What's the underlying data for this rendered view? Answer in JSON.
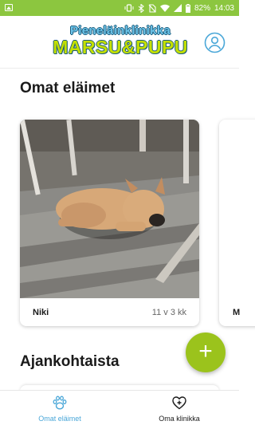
{
  "status_bar": {
    "battery": "82%",
    "time": "14:03"
  },
  "header": {
    "logo_line1": "Pieneläinklinikka",
    "logo_line2": "MARSU&PUPU",
    "profile_icon": "account-circle-icon"
  },
  "pets_section": {
    "title": "Omat eläimet",
    "pets": [
      {
        "name": "Niki",
        "age": "11 v 3 kk"
      },
      {
        "name": "M"
      }
    ]
  },
  "news_section": {
    "title": "Ajankohtaista"
  },
  "fab": {
    "label": "+"
  },
  "bottom_nav": {
    "items": [
      {
        "label": "Omat eläimet",
        "icon": "paw-icon",
        "active": true
      },
      {
        "label": "Oma klinikka",
        "icon": "clinic-heart-icon",
        "active": false
      }
    ]
  },
  "colors": {
    "status_bar": "#8cc63f",
    "accent_blue": "#4aa7d8",
    "fab_green": "#9bc31c"
  }
}
